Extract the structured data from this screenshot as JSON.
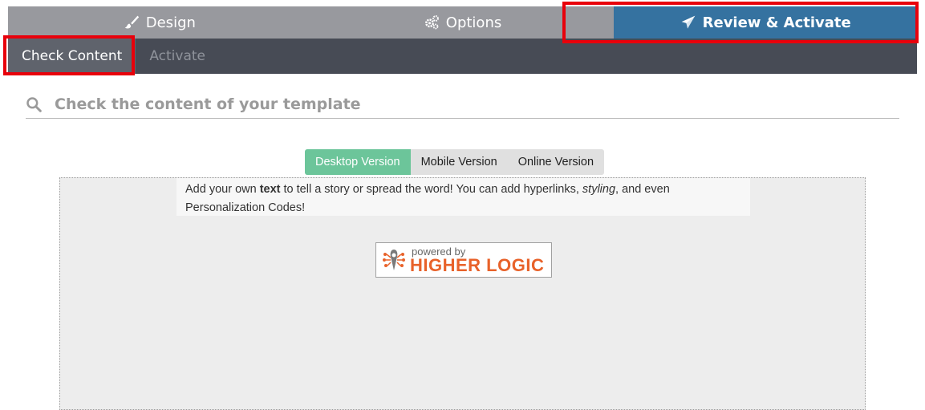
{
  "main_tabs": [
    {
      "label": "Design",
      "icon": "brush-icon"
    },
    {
      "label": "Options",
      "icon": "gears-icon"
    },
    {
      "label": "Review & Activate",
      "icon": "paper-plane-icon",
      "active": true
    }
  ],
  "sub_tabs": [
    {
      "label": "Check Content",
      "active": true
    },
    {
      "label": "Activate"
    }
  ],
  "search": {
    "label": "Check the content of your template",
    "icon": "search-icon"
  },
  "version_toggle": [
    {
      "label": "Desktop Version",
      "active": true
    },
    {
      "label": "Mobile Version"
    },
    {
      "label": "Online Version"
    }
  ],
  "preview": {
    "text_part1": "Add your own ",
    "text_bold": "text",
    "text_part2": " to tell a story or spread the word! You can add hyperlinks, ",
    "text_italic": "styling",
    "text_part3": ", and even Personalization Codes!",
    "logo_small": "powered by",
    "logo_big": "HIGHER LOGIC"
  },
  "colors": {
    "active_tab": "#3572a0",
    "tab_bg": "#98999e",
    "subnav_bg": "#474b55",
    "highlight": "#e8000b",
    "active_version": "#6cc59a",
    "logo_orange": "#e8622a"
  }
}
